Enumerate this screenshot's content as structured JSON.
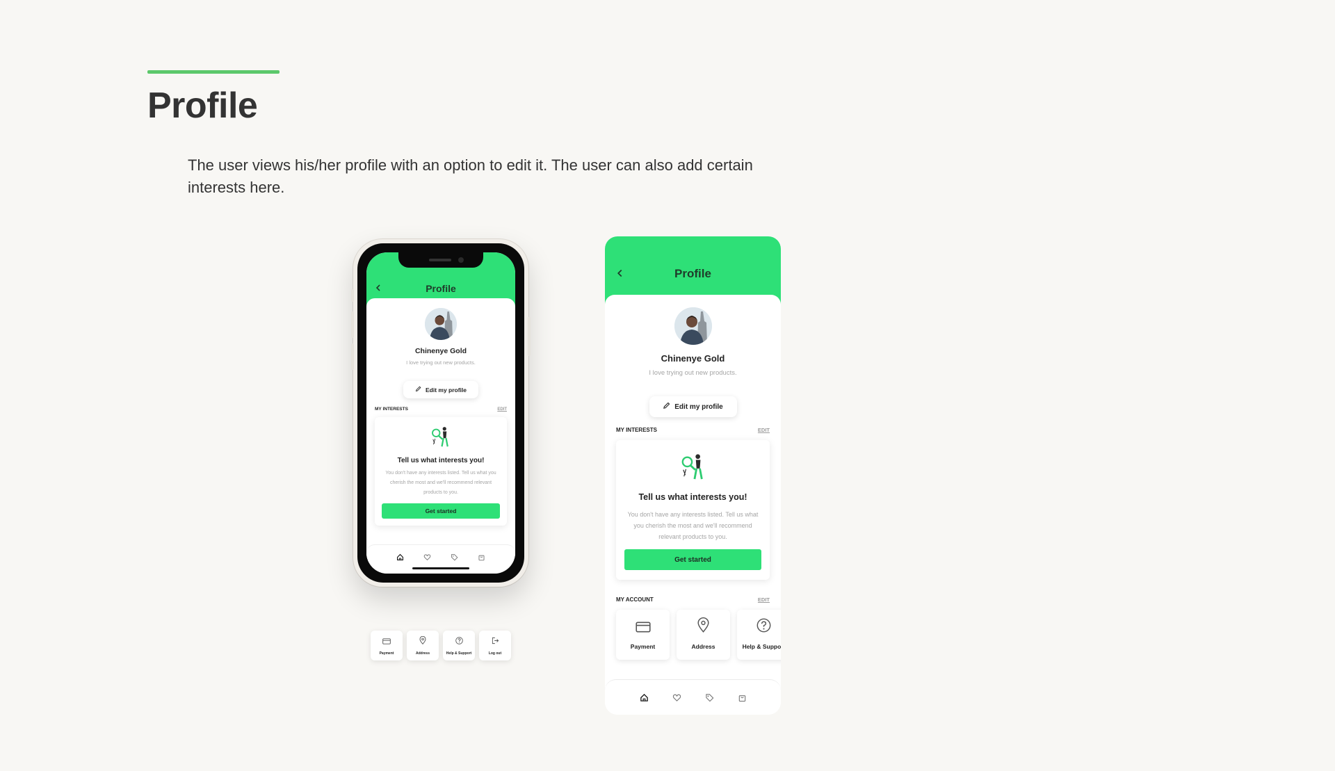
{
  "page": {
    "title": "Profile",
    "description": "The user views his/her profile with an option to edit it. The user can also add certain interests here."
  },
  "colors": {
    "accent_line": "#5cc86b",
    "header_green": "#2ee077",
    "background": "#f8f7f4"
  },
  "app": {
    "title": "Profile",
    "back_icon": "chevron-left-icon",
    "user": {
      "name": "Chinenye Gold",
      "bio": "I love trying out new products."
    },
    "edit_button": {
      "label": "Edit my profile",
      "icon": "pencil-icon"
    },
    "interests": {
      "title": "MY INTERESTS",
      "edit": "EDIT",
      "card_title": "Tell us what interests you!",
      "card_body": "You don't have any interests listed. Tell us what you cherish the most and we'll recommend relevant products to you.",
      "cta": "Get started"
    },
    "account": {
      "title": "MY ACCOUNT",
      "edit": "EDIT",
      "items": [
        {
          "label": "Payment",
          "icon": "credit-card-icon"
        },
        {
          "label": "Address",
          "icon": "map-pin-icon"
        },
        {
          "label": "Help & Support",
          "icon": "help-circle-icon"
        },
        {
          "label": "Log out",
          "icon": "log-out-icon"
        }
      ]
    },
    "nav": [
      {
        "icon": "home-icon",
        "active": true
      },
      {
        "icon": "heart-icon",
        "active": false
      },
      {
        "icon": "tag-icon",
        "active": false
      },
      {
        "icon": "bag-icon",
        "active": false
      }
    ]
  }
}
